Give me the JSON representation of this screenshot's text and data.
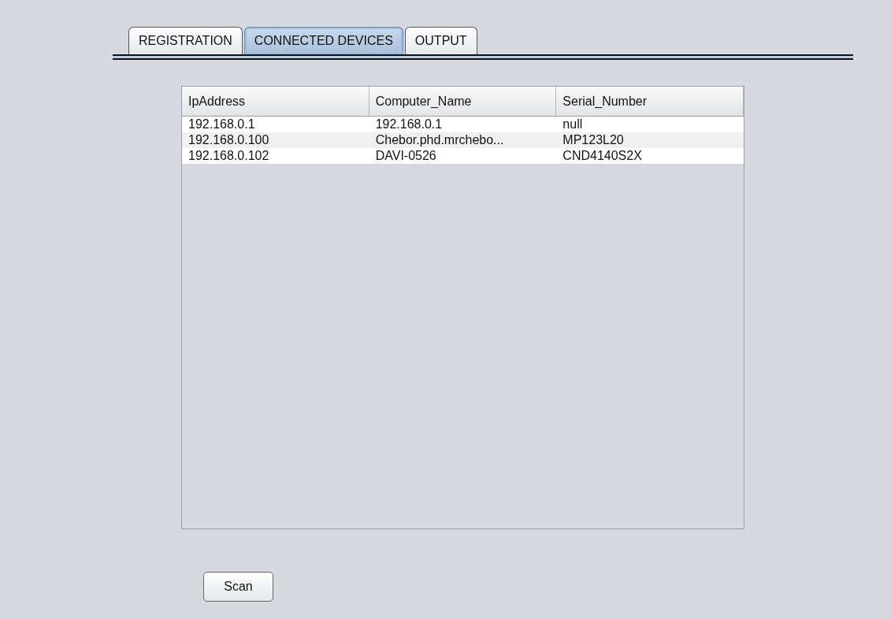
{
  "tabs": [
    {
      "label": "REGISTRATION",
      "selected": false
    },
    {
      "label": "CONNECTED DEVICES",
      "selected": true
    },
    {
      "label": "OUTPUT",
      "selected": false
    }
  ],
  "table": {
    "columns": [
      "IpAddress",
      "Computer_Name",
      "Serial_Number"
    ],
    "rows": [
      [
        "192.168.0.1",
        "192.168.0.1",
        "null"
      ],
      [
        "192.168.0.100",
        "Chebor.phd.mrchebo...",
        "MP123L20"
      ],
      [
        "192.168.0.102",
        "DAVI-0526",
        "CND4140S2X"
      ]
    ]
  },
  "buttons": [
    "Scan"
  ]
}
